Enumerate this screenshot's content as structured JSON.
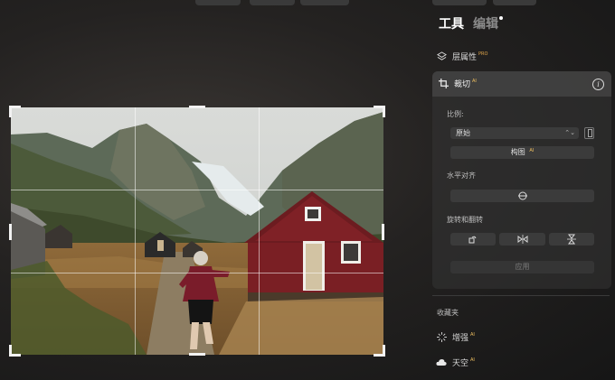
{
  "panel": {
    "tabs": [
      {
        "label": "工具",
        "active": true
      },
      {
        "label": "编辑",
        "active": false
      }
    ],
    "layer_properties": {
      "label": "层属性",
      "badge": "PRO"
    },
    "crop": {
      "title": "裁切",
      "badge": "AI",
      "ratio_label": "比例:",
      "ratio_value": "原始",
      "compose_button": "构图",
      "compose_badge": "AI",
      "straighten_label": "水平对齐",
      "rotate_flip_label": "旋转和翻转",
      "apply_button": "应用"
    },
    "favorites_label": "收藏夹",
    "favorites": [
      {
        "label": "增强",
        "badge": "AI"
      },
      {
        "label": "天空",
        "badge": "AI"
      }
    ]
  },
  "colors": {
    "accent_pro": "#e0a64b",
    "accent_ai": "#f0c060",
    "panel_bg": "#2b2b2b"
  },
  "icons": [
    "layers-icon",
    "crop-icon",
    "info-icon",
    "swap-orientation-icon",
    "straighten-icon",
    "rotate-icon",
    "flip-horizontal-icon",
    "flip-vertical-icon",
    "sparkle-icon",
    "cloud-icon"
  ]
}
